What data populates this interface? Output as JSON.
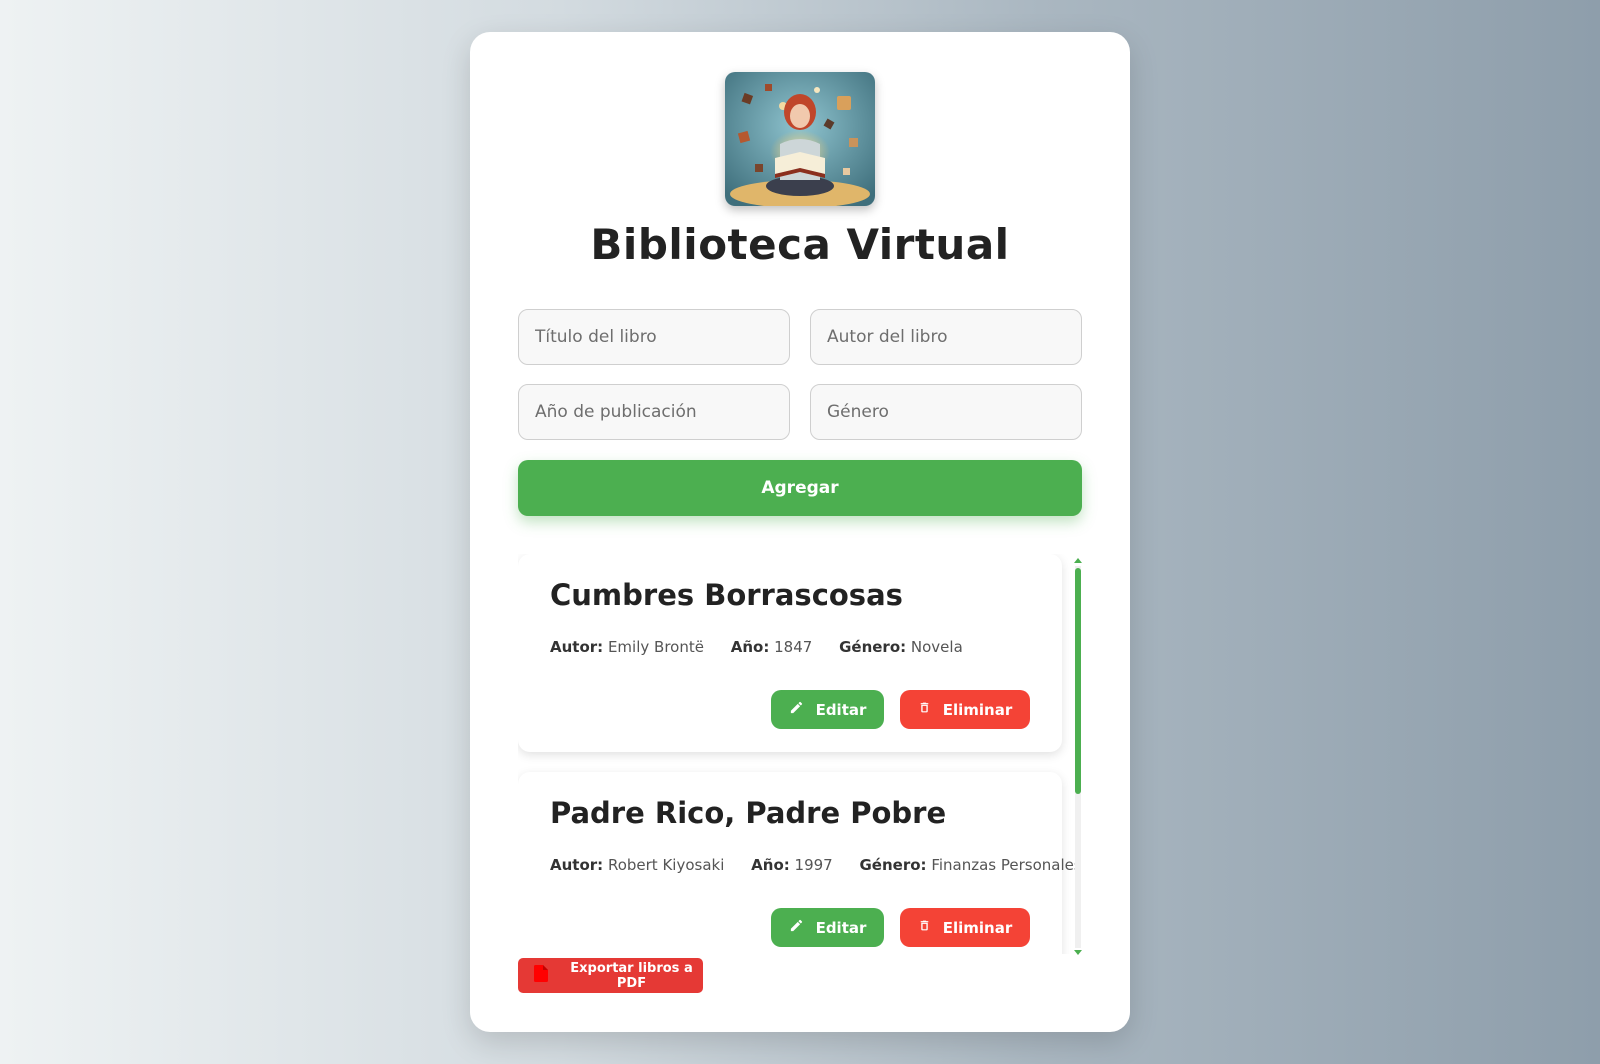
{
  "app": {
    "title": "Biblioteca Virtual"
  },
  "form": {
    "title_placeholder": "Título del libro",
    "author_placeholder": "Autor del libro",
    "year_placeholder": "Año de publicación",
    "genre_placeholder": "Género",
    "add_label": "Agregar"
  },
  "labels": {
    "author": "Autor:",
    "year": "Año:",
    "genre": "Género:",
    "edit": "Editar",
    "delete": "Eliminar"
  },
  "books": [
    {
      "title": "Cumbres Borrascosas",
      "author": "Emily Brontë",
      "year": "1847",
      "genre": "Novela"
    },
    {
      "title": "Padre Rico, Padre Pobre",
      "author": "Robert Kiyosaki",
      "year": "1997",
      "genre": "Finanzas Personales"
    }
  ],
  "export": {
    "label": "Exportar libros a PDF"
  },
  "colors": {
    "primary": "#4caf50",
    "danger": "#f44336",
    "export": "#e53935"
  },
  "icons": {
    "edit": "pencil-icon",
    "delete": "trash-icon",
    "export": "pdf-file-icon"
  }
}
